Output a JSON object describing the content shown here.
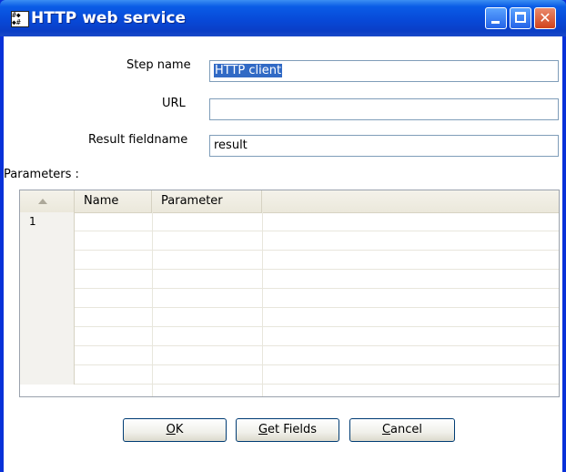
{
  "window": {
    "title": "HTTP web service",
    "buttons": {
      "minimize": "minimize-icon",
      "maximize": "maximize-icon",
      "close": "close-icon"
    }
  },
  "form": {
    "step_name_label": "Step name",
    "step_name_value": "HTTP client",
    "url_label": "URL",
    "url_value": "",
    "result_label": "Result fieldname",
    "result_value": "result",
    "parameters_label": "Parameters :"
  },
  "table": {
    "columns": [
      "Name",
      "Parameter"
    ],
    "rows": [
      {
        "num": "1",
        "name": "",
        "parameter": ""
      }
    ],
    "empty_rows": 9
  },
  "buttons": {
    "ok_accel": "O",
    "ok_rest": "K",
    "getfields_accel": "G",
    "getfields_rest": "et Fields",
    "cancel_accel": "C",
    "cancel_rest": "ancel"
  },
  "colors": {
    "titlebar": "#0a5ce6",
    "selection": "#316ac5",
    "close": "#d1421c"
  }
}
